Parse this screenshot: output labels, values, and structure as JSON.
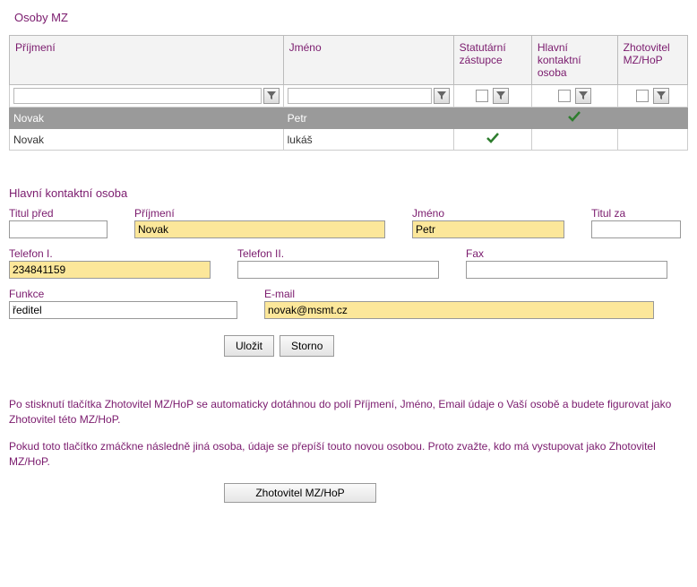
{
  "page_title": "Osoby MZ",
  "grid": {
    "headers": {
      "surname": "Příjmení",
      "firstname": "Jméno",
      "statutory": "Statutární zástupce",
      "main_contact": "Hlavní kontaktní osoba",
      "contractor": "Zhotovitel MZ/HoP"
    },
    "rows": [
      {
        "surname": "Novak",
        "firstname": "Petr",
        "statutory": false,
        "main_contact": true,
        "contractor": false,
        "selected": true
      },
      {
        "surname": "Novak",
        "firstname": "lukáš",
        "statutory": true,
        "main_contact": false,
        "contractor": false,
        "selected": false
      }
    ]
  },
  "detail": {
    "section_title": "Hlavní kontaktní osoba",
    "labels": {
      "title_before": "Titul před",
      "surname": "Příjmení",
      "firstname": "Jméno",
      "title_after": "Titul za",
      "phone1": "Telefon I.",
      "phone2": "Telefon II.",
      "fax": "Fax",
      "function": "Funkce",
      "email": "E-mail"
    },
    "values": {
      "title_before": "",
      "surname": "Novak",
      "firstname": "Petr",
      "title_after": "",
      "phone1": "234841159",
      "phone2": "",
      "fax": "",
      "function": "ředitel",
      "email": "novak@msmt.cz"
    },
    "buttons": {
      "save": "Uložit",
      "cancel": "Storno"
    }
  },
  "info": {
    "p1": "Po stisknutí tlačítka Zhotovitel MZ/HoP se automaticky dotáhnou do polí Příjmení, Jméno, Email údaje o Vaší osobě a budete figurovat jako Zhotovitel této MZ/HoP.",
    "p2": "Pokud toto tlačítko zmáčkne následně jiná osoba, údaje se přepíší touto novou osobou. Proto zvažte, kdo má vystupovat jako Zhotovitel MZ/HoP.",
    "button": "Zhotovitel MZ/HoP"
  }
}
